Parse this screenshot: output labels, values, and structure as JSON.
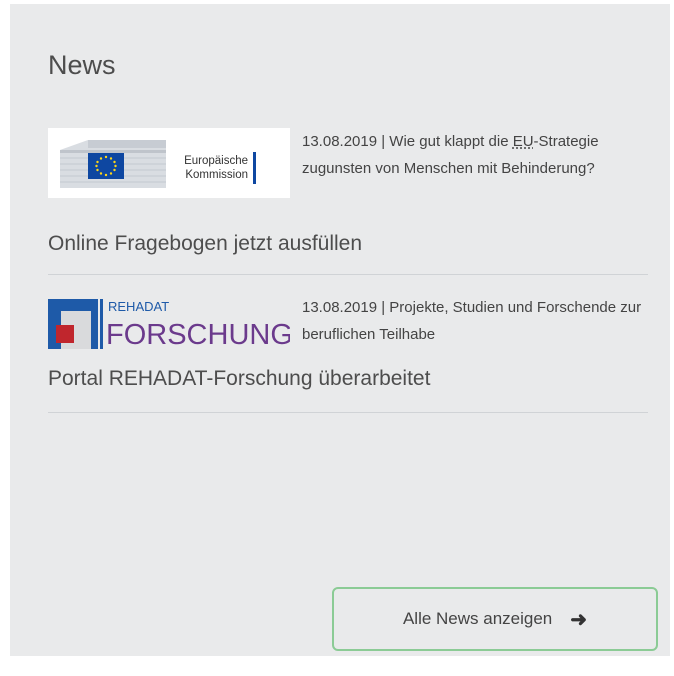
{
  "news": {
    "title": "News",
    "items": [
      {
        "image_text": [
          "Europäische",
          "Kommission"
        ],
        "teaser_before": "13.08.2019 | Wie gut klappt die ",
        "teaser_abbr": "EU",
        "teaser_after": "-Strategie zugunsten von Menschen mit Behinderung?",
        "headline": "Online Fragebogen jetzt ausfüllen"
      },
      {
        "image_text": [
          "REHADAT",
          "FORSCHUNG"
        ],
        "teaser_before": "13.08.2019 | Projekte, Studien und Forschende zur beruflichen Teilhabe",
        "headline": "Portal REHADAT-Forschung überarbeitet"
      }
    ],
    "all_button_label": "Alle News anzeigen"
  },
  "colors": {
    "panel_bg": "#e9eaeb",
    "button_border": "#8bcb95",
    "rehadat_blue": "#1e5aa8",
    "rehadat_red": "#c0262d",
    "forschung_purple": "#6b3a8c",
    "eu_blue": "#0e47a1"
  }
}
